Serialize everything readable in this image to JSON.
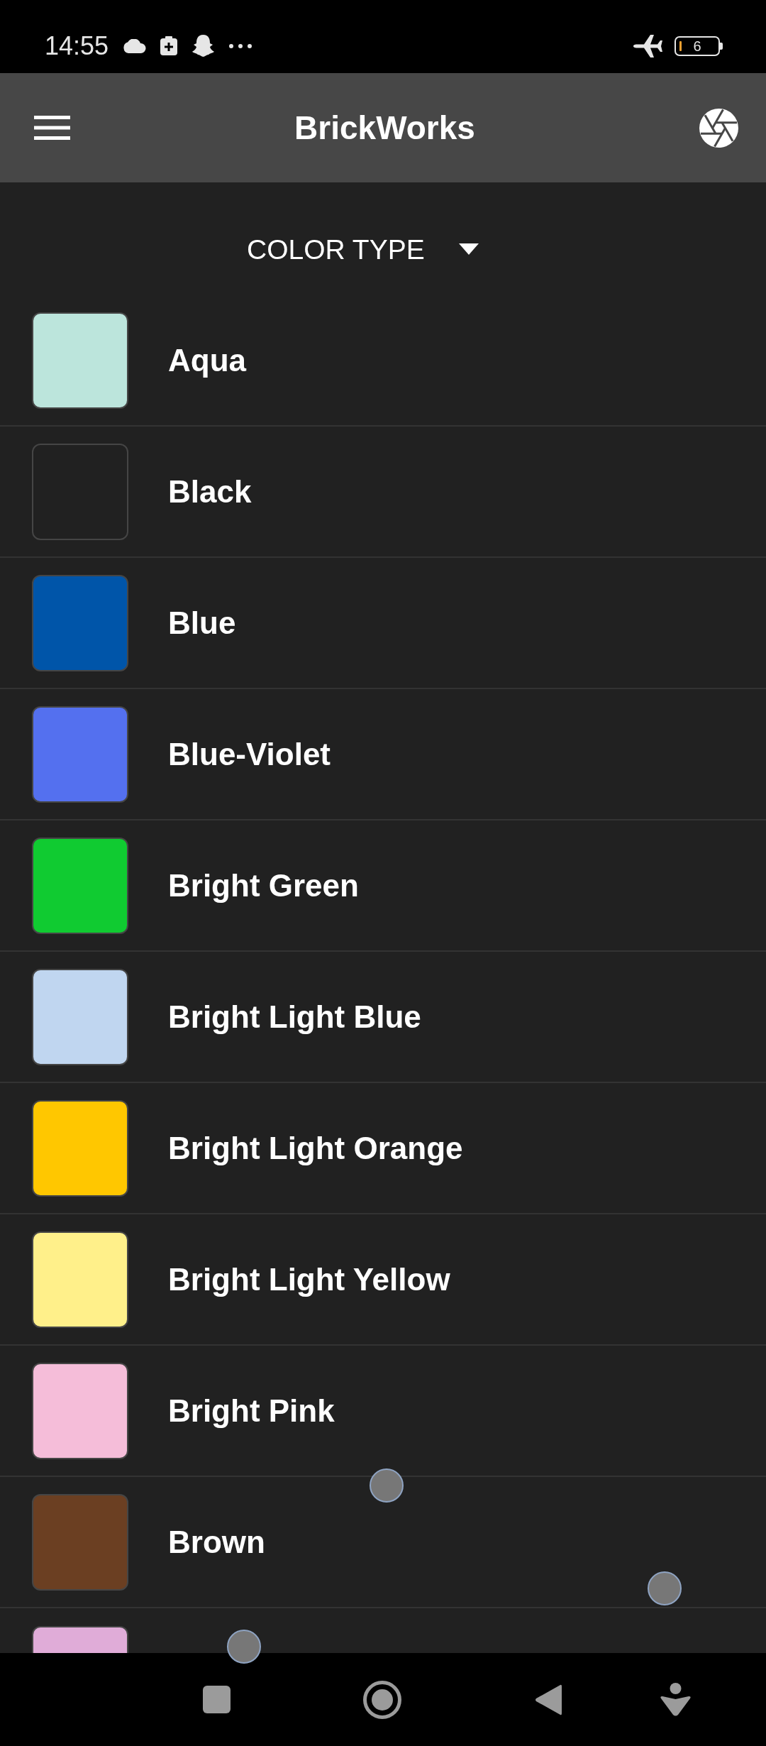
{
  "status_bar": {
    "time": "14:55",
    "battery": "6"
  },
  "app_bar": {
    "title": "BrickWorks"
  },
  "filter": {
    "label": "COLOR TYPE"
  },
  "colors": [
    {
      "name": "Aqua",
      "color": "#bce5dc"
    },
    {
      "name": "Black",
      "color": "#212121"
    },
    {
      "name": "Blue",
      "color": "#0055a9"
    },
    {
      "name": "Blue-Violet",
      "color": "#5470ef"
    },
    {
      "name": "Bright Green",
      "color": "#10cb31"
    },
    {
      "name": "Bright Light Blue",
      "color": "#c0d6f0"
    },
    {
      "name": "Bright Light Orange",
      "color": "#ffc700"
    },
    {
      "name": "Bright Light Yellow",
      "color": "#fff08a"
    },
    {
      "name": "Bright Pink",
      "color": "#f5bdd9"
    },
    {
      "name": "Brown",
      "color": "#6b3f22"
    },
    {
      "color": "#e0acd8"
    }
  ]
}
